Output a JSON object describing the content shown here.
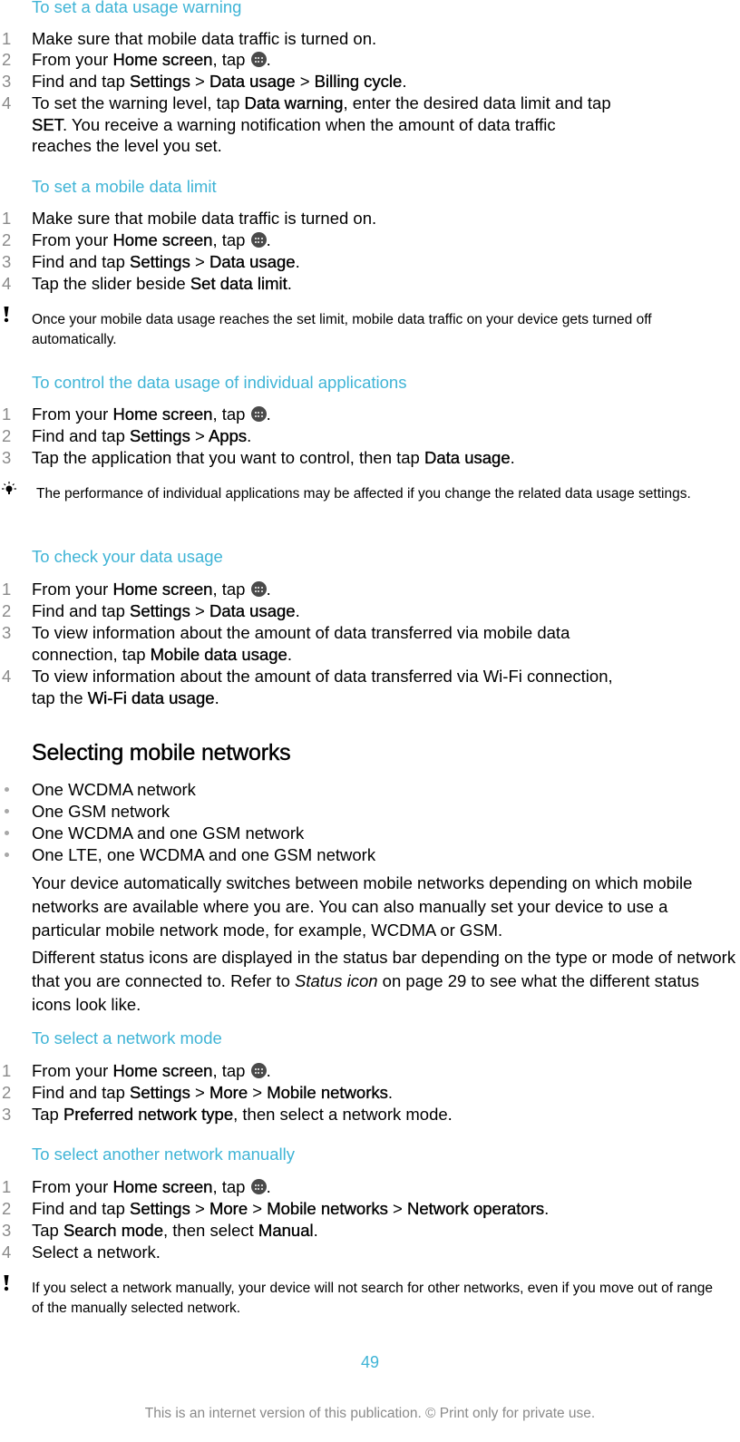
{
  "sections": {
    "warning": {
      "title": "To set a data usage warning",
      "steps": [
        {
          "num": "1",
          "parts": [
            "Make sure that mobile data traffic is turned on."
          ]
        },
        {
          "num": "2",
          "a": "From your ",
          "b": "Home screen",
          "c": ", tap ",
          "d": "."
        },
        {
          "num": "3",
          "a": "Find and tap ",
          "b1": "Settings",
          "s1": " > ",
          "b2": "Data usage",
          "s2": " > ",
          "b3": "Billing cycle",
          "end": "."
        },
        {
          "num": "4",
          "a": "To set the warning level, tap ",
          "b1": "Data warning",
          "m": ", enter the desired data limit and tap",
          "b2": "SET",
          "rest": ". You receive a warning notification when the amount of data traffic",
          "last": "reaches the level you set."
        }
      ]
    },
    "limit": {
      "title": "To set a mobile data limit",
      "steps": [
        {
          "num": "1",
          "text": "Make sure that mobile data traffic is turned on."
        },
        {
          "num": "2",
          "a": "From your ",
          "b": "Home screen",
          "c": ", tap ",
          "d": "."
        },
        {
          "num": "3",
          "a": "Find and tap ",
          "b1": "Settings",
          "s1": " > ",
          "b2": "Data usage",
          "end": "."
        },
        {
          "num": "4",
          "a": "Tap the slider beside ",
          "b": "Set data limit",
          "end": "."
        }
      ],
      "note": "Once your mobile data usage reaches the set limit, mobile data traffic on your device gets turned off automatically."
    },
    "control": {
      "title": "To control the data usage of individual applications",
      "steps": [
        {
          "num": "1",
          "a": "From your ",
          "b": "Home screen",
          "c": ", tap ",
          "d": "."
        },
        {
          "num": "2",
          "a": "Find and tap ",
          "b1": "Settings",
          "s1": " > ",
          "b2": "Apps",
          "end": "."
        },
        {
          "num": "3",
          "a": "Tap the application that you want to control, then tap ",
          "b": "Data usage",
          "end": "."
        }
      ],
      "tip": "The performance of individual applications may be affected if you change the related data usage settings."
    },
    "check": {
      "title": "To check your data usage",
      "steps": [
        {
          "num": "1",
          "a": "From your ",
          "b": "Home screen",
          "c": ", tap ",
          "d": "."
        },
        {
          "num": "2",
          "a": "Find and tap ",
          "b1": "Settings",
          "s1": " > ",
          "b2": "Data usage",
          "end": "."
        },
        {
          "num": "3",
          "a": "To view information about the amount of data transferred via mobile data",
          "a2": "connection, tap ",
          "b": "Mobile data usage",
          "end": "."
        },
        {
          "num": "4",
          "a": "To view information about the amount of data transferred via Wi-Fi connection,",
          "a2": "tap the ",
          "b": "Wi-Fi data usage",
          "end": "."
        }
      ]
    },
    "networks": {
      "title": "Selecting mobile networks",
      "bullets": [
        "One WCDMA network",
        "One GSM network",
        "One WCDMA and one GSM network",
        "One LTE, one WCDMA and one GSM network"
      ],
      "para1": "Your device automatically switches between mobile networks depending on which mobile networks are available where you are. You can also manually set your device to use a particular mobile network mode, for example, WCDMA or GSM.",
      "para2_a": "Different status icons are displayed in the status bar depending on the type or mode of network that you are connected to. Refer to ",
      "para2_link": "Status icon",
      "para2_b": " on page 29 to see what the different status icons look like."
    },
    "mode": {
      "title": "To select a network mode",
      "steps": [
        {
          "num": "1",
          "a": "From your ",
          "b": "Home screen",
          "c": ", tap ",
          "d": "."
        },
        {
          "num": "2",
          "a": "Find and tap ",
          "b1": "Settings",
          "s1": " > ",
          "b2": "More",
          "s2": " > ",
          "b3": "Mobile networks",
          "end": "."
        },
        {
          "num": "3",
          "a": "Tap ",
          "b": "Preferred network type",
          "end": ", then select a network mode."
        }
      ]
    },
    "manual": {
      "title": "To select another network manually",
      "steps": [
        {
          "num": "1",
          "a": "From your ",
          "b": "Home screen",
          "c": ", tap ",
          "d": "."
        },
        {
          "num": "2",
          "a": "Find and tap ",
          "b1": "Settings",
          "s1": " > ",
          "b2": "More",
          "s2": " > ",
          "b3": "Mobile networks",
          "s3": " > ",
          "b4": "Network operators",
          "end": "."
        },
        {
          "num": "3",
          "a": "Tap ",
          "b1": "Search mode",
          "m": ", then select ",
          "b2": "Manual",
          "end": "."
        },
        {
          "num": "4",
          "text": "Select a network."
        }
      ],
      "note": "If you select a network manually, your device will not search for other networks, even if you move out of range of the manually selected network."
    }
  },
  "page_number": "49",
  "footer": "This is an internet version of this publication. © Print only for private use.",
  "colors": {
    "accent": "#3fb4d6",
    "step_number": "#8a8a8a",
    "apps_icon": "#4a4a4a"
  }
}
